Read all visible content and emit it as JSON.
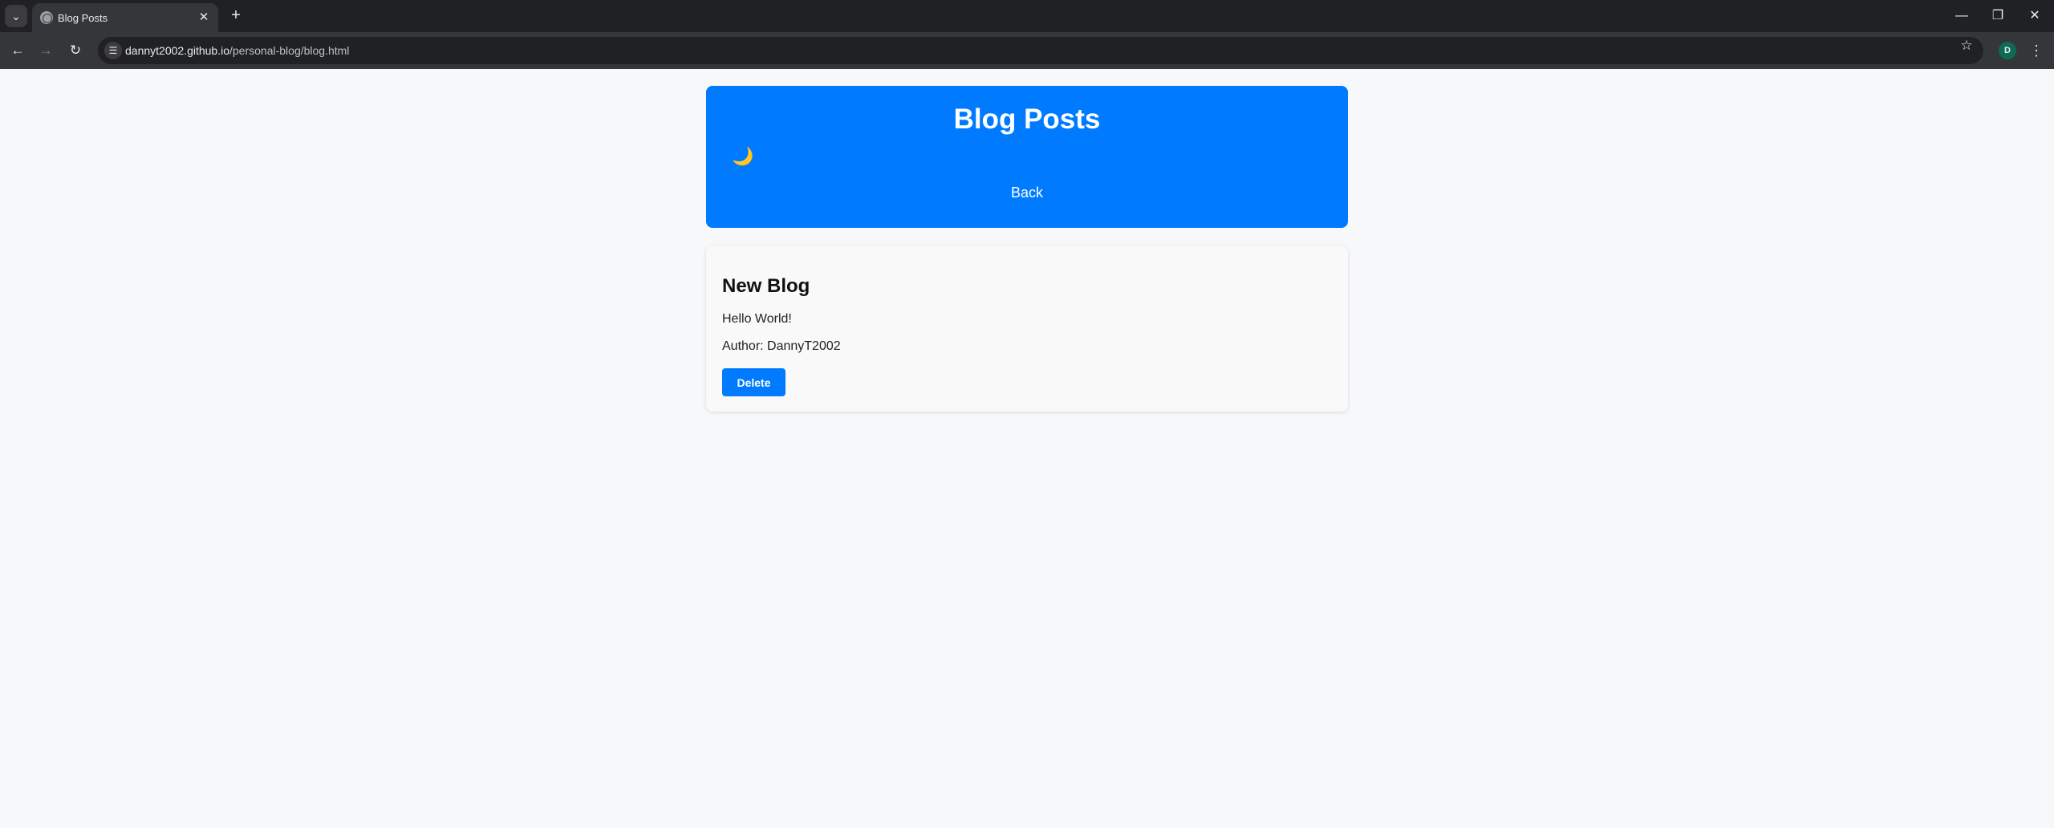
{
  "browser": {
    "tab_title": "Blog Posts",
    "tab_close_glyph": "✕",
    "new_tab_glyph": "+",
    "url_host": "dannyt2002.github.io",
    "url_path": "/personal-blog/blog.html",
    "profile_initial": "D",
    "icons": {
      "tab_search": "chevron-down-icon",
      "favicon": "globe-icon",
      "back": "arrow-left-icon",
      "forward": "arrow-right-icon",
      "reload": "reload-icon",
      "site_info": "tune-icon",
      "bookmark": "star-icon",
      "menu": "kebab-menu-icon"
    }
  },
  "header": {
    "title": "Blog Posts",
    "theme_toggle_glyph": "🌙",
    "back_label": "Back"
  },
  "posts": [
    {
      "title": "New Blog",
      "body": "Hello World!",
      "author": "Author: DannyT2002",
      "delete_label": "Delete"
    }
  ],
  "colors": {
    "header_bg": "#007bff",
    "button_bg": "#007bff",
    "page_bg": "#f7f8fa",
    "card_bg": "#f9f9f9"
  }
}
